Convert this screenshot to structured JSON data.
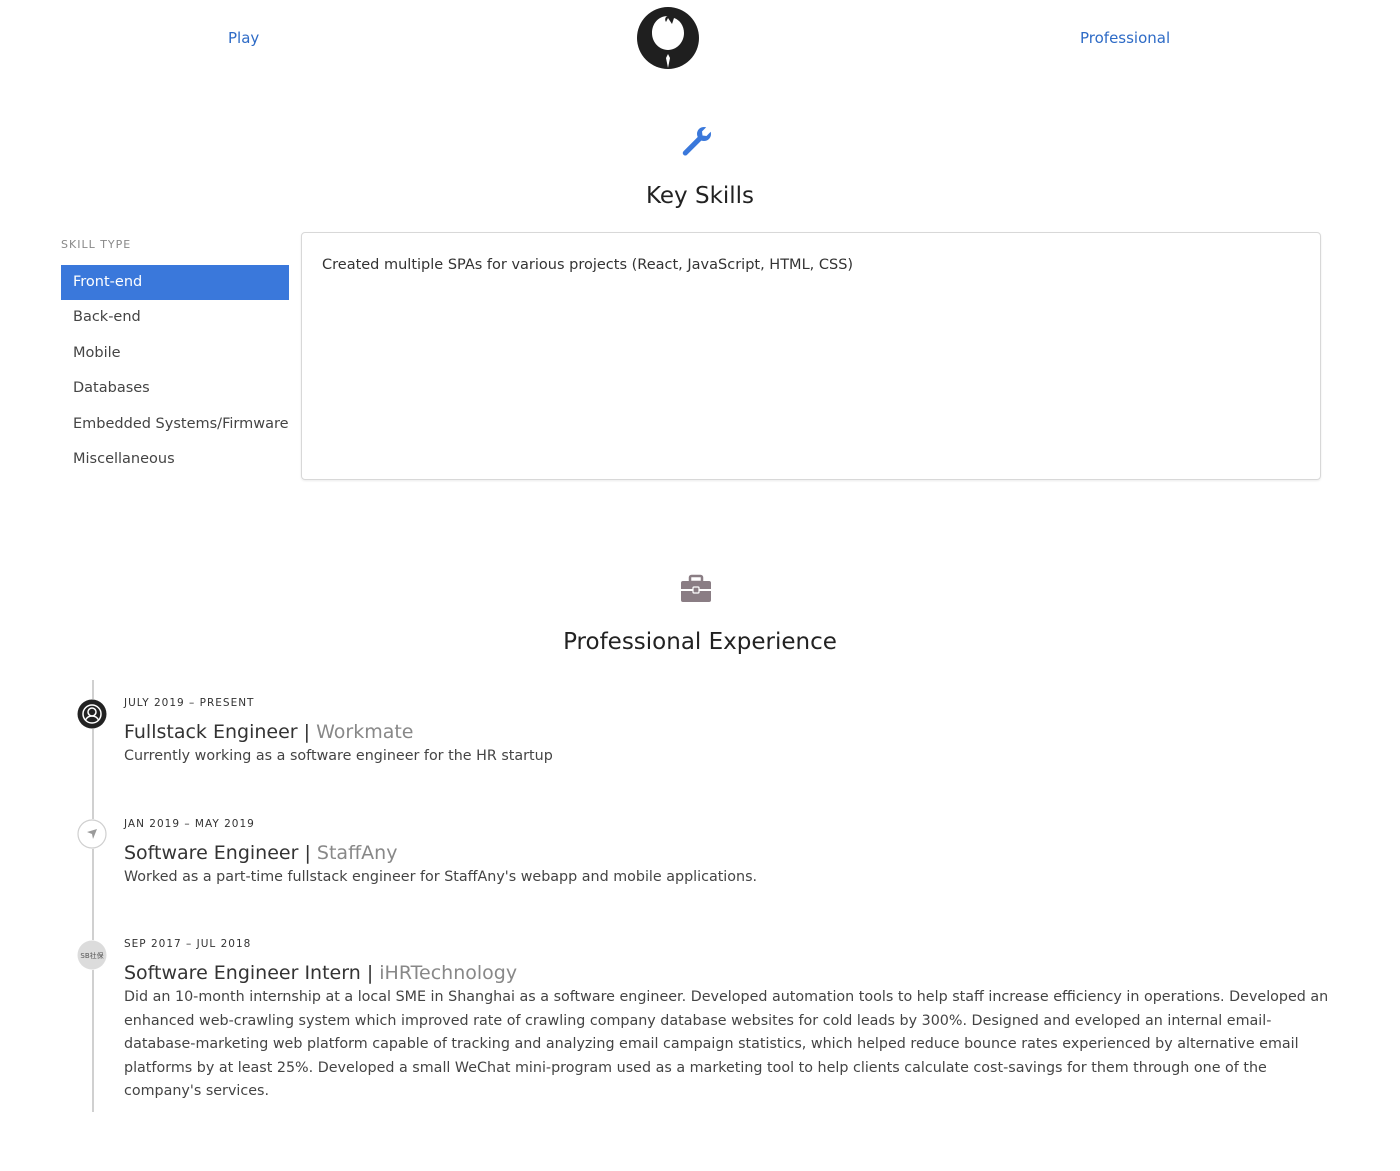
{
  "nav": {
    "left_link": "Play",
    "right_link": "Professional"
  },
  "skills": {
    "title": "Key Skills",
    "type_label": "SKILL TYPE",
    "items": [
      {
        "label": "Front-end",
        "active": true
      },
      {
        "label": "Back-end",
        "active": false
      },
      {
        "label": "Mobile",
        "active": false
      },
      {
        "label": "Databases",
        "active": false
      },
      {
        "label": "Embedded Systems/Firmware",
        "active": false
      },
      {
        "label": "Miscellaneous",
        "active": false
      }
    ],
    "panel_text": "Created multiple SPAs for various projects (React, JavaScript, HTML, CSS)"
  },
  "experience": {
    "title": "Professional Experience",
    "entries": [
      {
        "date": "JULY 2019 – PRESENT",
        "role": "Fullstack Engineer",
        "separator": "|",
        "company": "Workmate",
        "description": "Currently working as a software engineer for the HR startup",
        "icon": "workmate-logo-icon"
      },
      {
        "date": "JAN 2019 – MAY 2019",
        "role": "Software Engineer",
        "separator": "|",
        "company": "StaffAny",
        "description": "Worked as a part-time fullstack engineer for StaffAny's webapp and mobile applications.",
        "icon": "staffany-logo-icon"
      },
      {
        "date": "SEP 2017 – JUL 2018",
        "role": "Software Engineer Intern",
        "separator": "|",
        "company": "iHRTechnology",
        "description": "Did an 10-month internship at a local SME in Shanghai as a software engineer. Developed automation tools to help staff increase efficiency in operations. Developed an enhanced web-crawling system which improved rate of crawling company database websites for cold leads by 300%. Designed and eveloped an internal email-database-marketing web platform capable of tracking and analyzing email campaign statistics, which helped reduce bounce rates experienced by alternative email platforms by at least 25%. Developed a small WeChat mini-program used as a marketing tool to help clients calculate cost-savings for them through one of the company's services.",
        "icon": "ihrtechnology-logo-icon",
        "icon_text": "SB社保"
      }
    ]
  },
  "colors": {
    "accent": "#3a78db",
    "link": "#2e6bc6",
    "company_gray": "#888888"
  }
}
